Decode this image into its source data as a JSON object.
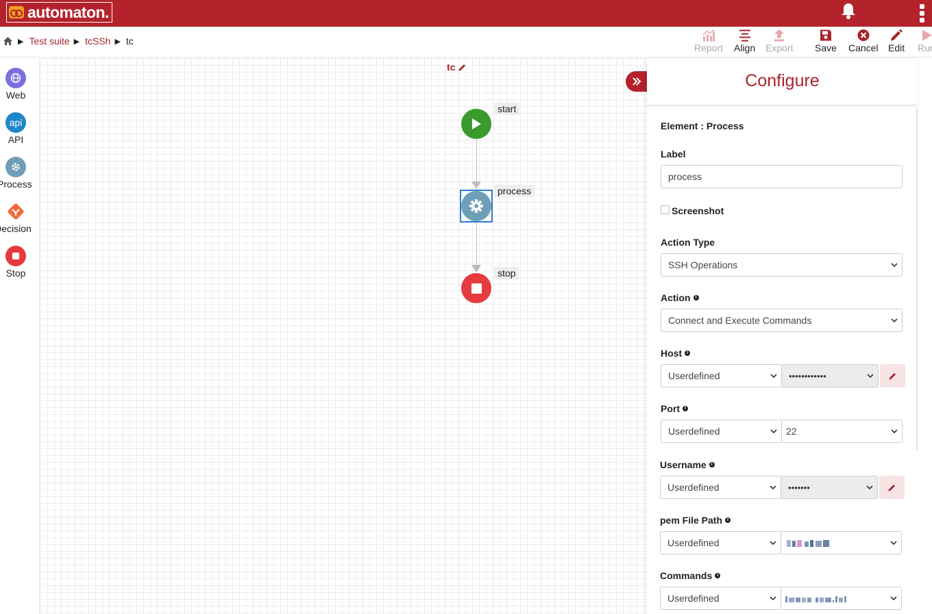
{
  "app": {
    "name": "automaton."
  },
  "breadcrumb": {
    "items": [
      "Test suite",
      "tcSSh"
    ],
    "current": "tc"
  },
  "toolbar": {
    "report": "Report",
    "align": "Align",
    "export": "Export",
    "save": "Save",
    "cancel": "Cancel",
    "edit": "Edit",
    "run": "Run"
  },
  "palette": {
    "web": "Web",
    "api": "API",
    "api_glyph": "api",
    "process": "Process",
    "decision": "Decision",
    "stop": "Stop"
  },
  "canvas": {
    "title": "tc",
    "nodes": {
      "start": "start",
      "process": "process",
      "stop": "stop"
    }
  },
  "configure": {
    "title": "Configure",
    "element": "Element : Process",
    "label": {
      "label": "Label",
      "value": "process"
    },
    "screenshot": {
      "label": "Screenshot",
      "checked": false
    },
    "action_type": {
      "label": "Action Type",
      "value": "SSH Operations"
    },
    "action": {
      "label": "Action",
      "value": "Connect and Execute Commands"
    },
    "host": {
      "label": "Host",
      "source": "Userdefined",
      "value": "••••••••••••"
    },
    "port": {
      "label": "Port",
      "source": "Userdefined",
      "value": "22"
    },
    "username": {
      "label": "Username",
      "source": "Userdefined",
      "value": "•••••••"
    },
    "pem": {
      "label": "pem File Path",
      "source": "Userdefined"
    },
    "commands": {
      "label": "Commands",
      "source": "Userdefined"
    }
  },
  "colors": {
    "brand": "#b4232b",
    "start": "#3a9a2e",
    "process": "#6f9fb6",
    "stop": "#e53a40",
    "web": "#7b6fe0",
    "api": "#1f86c8",
    "decision": "#f26b3a"
  }
}
